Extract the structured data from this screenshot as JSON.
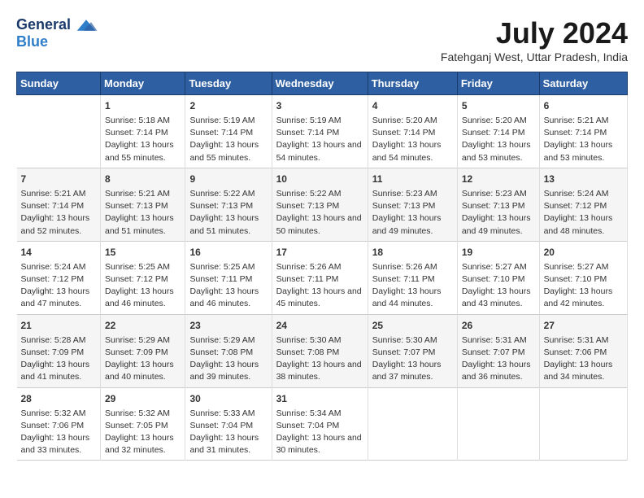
{
  "logo": {
    "general": "General",
    "blue": "Blue"
  },
  "title": {
    "month_year": "July 2024",
    "location": "Fatehganj West, Uttar Pradesh, India"
  },
  "days_header": [
    "Sunday",
    "Monday",
    "Tuesday",
    "Wednesday",
    "Thursday",
    "Friday",
    "Saturday"
  ],
  "weeks": [
    [
      {
        "num": "",
        "sunrise": "",
        "sunset": "",
        "daylight": ""
      },
      {
        "num": "1",
        "sunrise": "Sunrise: 5:18 AM",
        "sunset": "Sunset: 7:14 PM",
        "daylight": "Daylight: 13 hours and 55 minutes."
      },
      {
        "num": "2",
        "sunrise": "Sunrise: 5:19 AM",
        "sunset": "Sunset: 7:14 PM",
        "daylight": "Daylight: 13 hours and 55 minutes."
      },
      {
        "num": "3",
        "sunrise": "Sunrise: 5:19 AM",
        "sunset": "Sunset: 7:14 PM",
        "daylight": "Daylight: 13 hours and 54 minutes."
      },
      {
        "num": "4",
        "sunrise": "Sunrise: 5:20 AM",
        "sunset": "Sunset: 7:14 PM",
        "daylight": "Daylight: 13 hours and 54 minutes."
      },
      {
        "num": "5",
        "sunrise": "Sunrise: 5:20 AM",
        "sunset": "Sunset: 7:14 PM",
        "daylight": "Daylight: 13 hours and 53 minutes."
      },
      {
        "num": "6",
        "sunrise": "Sunrise: 5:21 AM",
        "sunset": "Sunset: 7:14 PM",
        "daylight": "Daylight: 13 hours and 53 minutes."
      }
    ],
    [
      {
        "num": "7",
        "sunrise": "Sunrise: 5:21 AM",
        "sunset": "Sunset: 7:14 PM",
        "daylight": "Daylight: 13 hours and 52 minutes."
      },
      {
        "num": "8",
        "sunrise": "Sunrise: 5:21 AM",
        "sunset": "Sunset: 7:13 PM",
        "daylight": "Daylight: 13 hours and 51 minutes."
      },
      {
        "num": "9",
        "sunrise": "Sunrise: 5:22 AM",
        "sunset": "Sunset: 7:13 PM",
        "daylight": "Daylight: 13 hours and 51 minutes."
      },
      {
        "num": "10",
        "sunrise": "Sunrise: 5:22 AM",
        "sunset": "Sunset: 7:13 PM",
        "daylight": "Daylight: 13 hours and 50 minutes."
      },
      {
        "num": "11",
        "sunrise": "Sunrise: 5:23 AM",
        "sunset": "Sunset: 7:13 PM",
        "daylight": "Daylight: 13 hours and 49 minutes."
      },
      {
        "num": "12",
        "sunrise": "Sunrise: 5:23 AM",
        "sunset": "Sunset: 7:13 PM",
        "daylight": "Daylight: 13 hours and 49 minutes."
      },
      {
        "num": "13",
        "sunrise": "Sunrise: 5:24 AM",
        "sunset": "Sunset: 7:12 PM",
        "daylight": "Daylight: 13 hours and 48 minutes."
      }
    ],
    [
      {
        "num": "14",
        "sunrise": "Sunrise: 5:24 AM",
        "sunset": "Sunset: 7:12 PM",
        "daylight": "Daylight: 13 hours and 47 minutes."
      },
      {
        "num": "15",
        "sunrise": "Sunrise: 5:25 AM",
        "sunset": "Sunset: 7:12 PM",
        "daylight": "Daylight: 13 hours and 46 minutes."
      },
      {
        "num": "16",
        "sunrise": "Sunrise: 5:25 AM",
        "sunset": "Sunset: 7:11 PM",
        "daylight": "Daylight: 13 hours and 46 minutes."
      },
      {
        "num": "17",
        "sunrise": "Sunrise: 5:26 AM",
        "sunset": "Sunset: 7:11 PM",
        "daylight": "Daylight: 13 hours and 45 minutes."
      },
      {
        "num": "18",
        "sunrise": "Sunrise: 5:26 AM",
        "sunset": "Sunset: 7:11 PM",
        "daylight": "Daylight: 13 hours and 44 minutes."
      },
      {
        "num": "19",
        "sunrise": "Sunrise: 5:27 AM",
        "sunset": "Sunset: 7:10 PM",
        "daylight": "Daylight: 13 hours and 43 minutes."
      },
      {
        "num": "20",
        "sunrise": "Sunrise: 5:27 AM",
        "sunset": "Sunset: 7:10 PM",
        "daylight": "Daylight: 13 hours and 42 minutes."
      }
    ],
    [
      {
        "num": "21",
        "sunrise": "Sunrise: 5:28 AM",
        "sunset": "Sunset: 7:09 PM",
        "daylight": "Daylight: 13 hours and 41 minutes."
      },
      {
        "num": "22",
        "sunrise": "Sunrise: 5:29 AM",
        "sunset": "Sunset: 7:09 PM",
        "daylight": "Daylight: 13 hours and 40 minutes."
      },
      {
        "num": "23",
        "sunrise": "Sunrise: 5:29 AM",
        "sunset": "Sunset: 7:08 PM",
        "daylight": "Daylight: 13 hours and 39 minutes."
      },
      {
        "num": "24",
        "sunrise": "Sunrise: 5:30 AM",
        "sunset": "Sunset: 7:08 PM",
        "daylight": "Daylight: 13 hours and 38 minutes."
      },
      {
        "num": "25",
        "sunrise": "Sunrise: 5:30 AM",
        "sunset": "Sunset: 7:07 PM",
        "daylight": "Daylight: 13 hours and 37 minutes."
      },
      {
        "num": "26",
        "sunrise": "Sunrise: 5:31 AM",
        "sunset": "Sunset: 7:07 PM",
        "daylight": "Daylight: 13 hours and 36 minutes."
      },
      {
        "num": "27",
        "sunrise": "Sunrise: 5:31 AM",
        "sunset": "Sunset: 7:06 PM",
        "daylight": "Daylight: 13 hours and 34 minutes."
      }
    ],
    [
      {
        "num": "28",
        "sunrise": "Sunrise: 5:32 AM",
        "sunset": "Sunset: 7:06 PM",
        "daylight": "Daylight: 13 hours and 33 minutes."
      },
      {
        "num": "29",
        "sunrise": "Sunrise: 5:32 AM",
        "sunset": "Sunset: 7:05 PM",
        "daylight": "Daylight: 13 hours and 32 minutes."
      },
      {
        "num": "30",
        "sunrise": "Sunrise: 5:33 AM",
        "sunset": "Sunset: 7:04 PM",
        "daylight": "Daylight: 13 hours and 31 minutes."
      },
      {
        "num": "31",
        "sunrise": "Sunrise: 5:34 AM",
        "sunset": "Sunset: 7:04 PM",
        "daylight": "Daylight: 13 hours and 30 minutes."
      },
      {
        "num": "",
        "sunrise": "",
        "sunset": "",
        "daylight": ""
      },
      {
        "num": "",
        "sunrise": "",
        "sunset": "",
        "daylight": ""
      },
      {
        "num": "",
        "sunrise": "",
        "sunset": "",
        "daylight": ""
      }
    ]
  ]
}
